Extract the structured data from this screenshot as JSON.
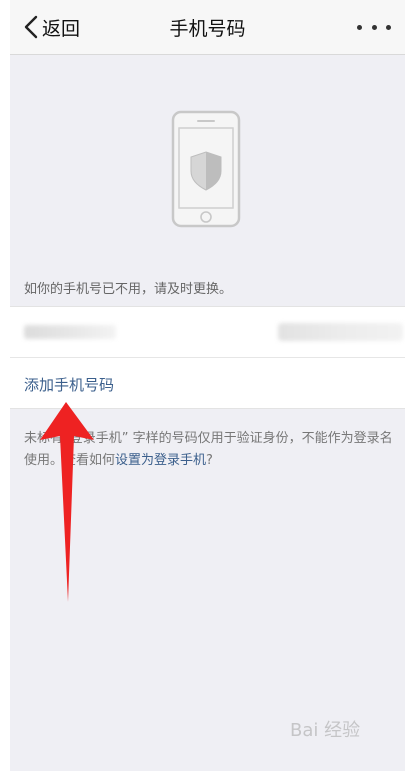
{
  "header": {
    "back_label": "返回",
    "title": "手机号码",
    "back_icon": "chevron-left-icon",
    "more_icon": "more-dots-icon"
  },
  "illustration": {
    "icon": "phone-shield-icon"
  },
  "hint_text": "如你的手机号已不用，请及时更换。",
  "phone_list": {
    "add_label": "添加手机号码"
  },
  "note": {
    "text_before": "未标有“登录手机” 字样的号码仅用于验证身份，不能作为登录名使用。查看如何",
    "link_label": "设置为登录手机",
    "text_after": "?"
  },
  "watermark": "Bai 经验"
}
